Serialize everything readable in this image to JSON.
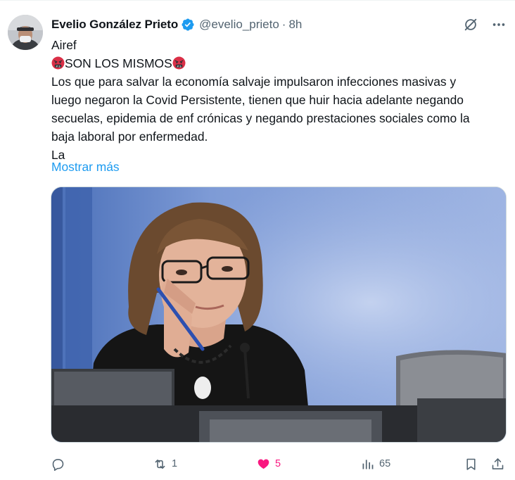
{
  "author": {
    "display_name": "Evelio González Prieto",
    "handle": "@evelio_prieto",
    "separator": "·",
    "time": "8h",
    "verified": true
  },
  "tweet": {
    "lines": [
      "Airef",
      "SON LOS MISMOS",
      "Los que para salvar la economía salvaje impulsaron infecciones masivas y",
      "luego negaron la Covid Persistente, tienen que huir hacia adelante negando",
      "secuelas, epidemia de enf crónicas y negando prestaciones sociales como la",
      "baja laboral por enfermedad.",
      "La"
    ],
    "show_more": "Mostrar más",
    "emoji": "angry-face-with-symbols"
  },
  "actions": {
    "reply": {
      "icon": "reply-icon",
      "count": ""
    },
    "retweet": {
      "icon": "retweet-icon",
      "count": "1"
    },
    "like": {
      "icon": "heart-icon",
      "count": "5",
      "active": true,
      "color": "#f91880"
    },
    "views": {
      "icon": "views-icon",
      "count": "65"
    },
    "bookmark": {
      "icon": "bookmark-icon"
    },
    "share": {
      "icon": "share-icon"
    }
  },
  "colors": {
    "link": "#1d9bf0",
    "secondary_text": "#536471",
    "verified": "#1d9bf0",
    "like": "#f91880"
  }
}
